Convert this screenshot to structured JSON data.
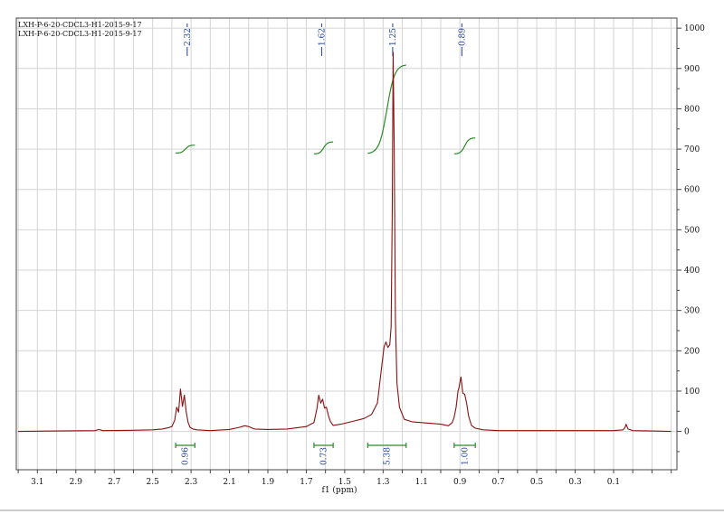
{
  "header_lines": [
    "LXH-P-6-20-CDCL3-H1-2015-9-17",
    "LXH-P-6-20-CDCL3-H1-2015-9-17"
  ],
  "chart_data": {
    "type": "line",
    "title": "",
    "xlabel": "f1 (ppm)",
    "ylabel": "",
    "x_reversed": true,
    "xlim": [
      3.21,
      -0.23
    ],
    "ylim": [
      -95,
      1025
    ],
    "x_ticks": [
      "3.1",
      "2.9",
      "2.7",
      "2.5",
      "2.3",
      "2.1",
      "1.9",
      "1.7",
      "1.5",
      "1.3",
      "1.1",
      "0.9",
      "0.7",
      "0.5",
      "0.3",
      "0.1"
    ],
    "y_ticks": [
      "1000",
      "900",
      "800",
      "700",
      "600",
      "500",
      "400",
      "300",
      "200",
      "100",
      "0"
    ],
    "grid": true,
    "peak_labels": [
      {
        "ppm": 2.32,
        "text": "2.32"
      },
      {
        "ppm": 1.62,
        "text": "1.62"
      },
      {
        "ppm": 1.25,
        "text": "1.25"
      },
      {
        "ppm": 0.89,
        "text": "0.89"
      }
    ],
    "integrals": [
      {
        "from": 2.38,
        "to": 2.28,
        "value": "0.96",
        "curve_y": [
          690,
          710
        ]
      },
      {
        "from": 1.66,
        "to": 1.56,
        "value": "0.73",
        "curve_y": [
          688,
          718
        ]
      },
      {
        "from": 1.38,
        "to": 1.18,
        "value": "5.38",
        "curve_y": [
          688,
          910
        ]
      },
      {
        "from": 0.93,
        "to": 0.82,
        "value": "1.00",
        "curve_y": [
          688,
          728
        ]
      }
    ],
    "series": [
      {
        "color": "#8b1010",
        "x": [
          3.2,
          3.0,
          2.8,
          2.78,
          2.76,
          2.6,
          2.5,
          2.45,
          2.42,
          2.4,
          2.385,
          2.375,
          2.365,
          2.355,
          2.345,
          2.335,
          2.325,
          2.315,
          2.305,
          2.29,
          2.27,
          2.2,
          2.1,
          2.05,
          2.02,
          2.0,
          1.97,
          1.9,
          1.8,
          1.7,
          1.66,
          1.645,
          1.635,
          1.625,
          1.615,
          1.605,
          1.595,
          1.585,
          1.575,
          1.56,
          1.52,
          1.45,
          1.4,
          1.36,
          1.33,
          1.31,
          1.295,
          1.285,
          1.275,
          1.265,
          1.258,
          1.252,
          1.248,
          1.242,
          1.236,
          1.228,
          1.215,
          1.19,
          1.15,
          1.1,
          1.05,
          1.0,
          0.96,
          0.94,
          0.93,
          0.92,
          0.91,
          0.905,
          0.895,
          0.885,
          0.875,
          0.865,
          0.855,
          0.84,
          0.82,
          0.78,
          0.7,
          0.5,
          0.3,
          0.1,
          0.05,
          0.04,
          0.035,
          0.025,
          0.0,
          -0.1,
          -0.2
        ],
        "y": [
          0,
          1,
          2,
          5,
          2,
          3,
          4,
          6,
          9,
          12,
          28,
          60,
          48,
          105,
          62,
          90,
          48,
          22,
          10,
          6,
          4,
          2,
          5,
          10,
          14,
          12,
          6,
          5,
          6,
          12,
          22,
          55,
          90,
          70,
          80,
          58,
          60,
          40,
          25,
          15,
          18,
          26,
          32,
          42,
          70,
          150,
          210,
          222,
          208,
          215,
          260,
          560,
          940,
          700,
          280,
          120,
          60,
          30,
          24,
          22,
          20,
          18,
          14,
          22,
          35,
          60,
          100,
          108,
          135,
          95,
          92,
          70,
          38,
          15,
          8,
          4,
          2,
          2,
          2,
          2,
          4,
          10,
          18,
          6,
          2,
          1,
          0
        ]
      }
    ]
  }
}
